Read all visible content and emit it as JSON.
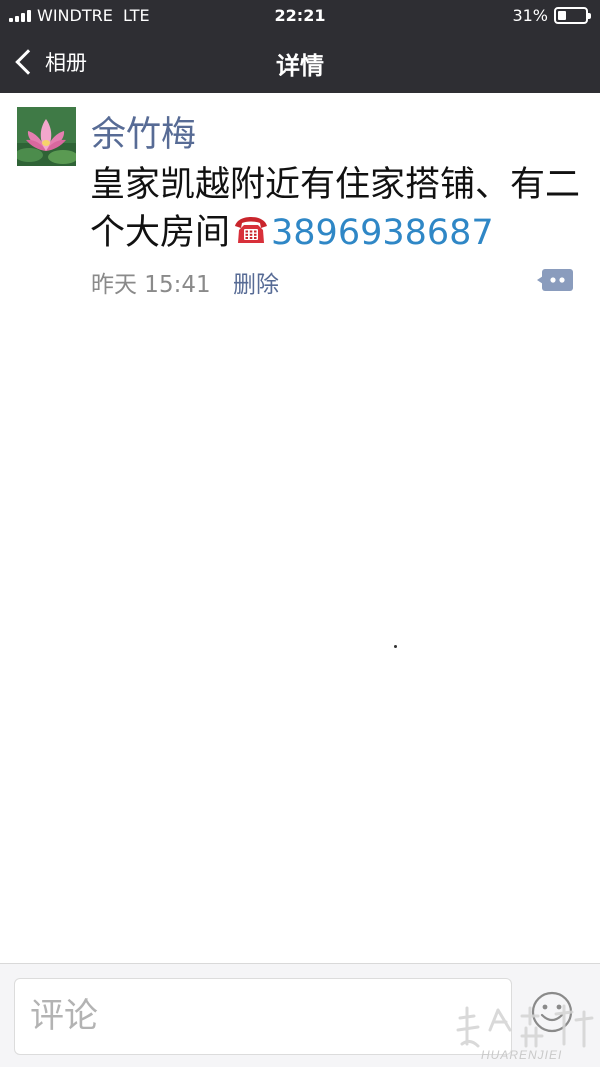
{
  "status_bar": {
    "carrier": "WINDTRE  LTE",
    "time": "22:21",
    "battery": "31%",
    "battery_level": 0.31
  },
  "nav": {
    "back_label": "相册",
    "title": "详情"
  },
  "post": {
    "author": "余竹梅",
    "text": "皇家凯越附近有住家搭铺、有二个大房间",
    "phone": "3896938687",
    "time": "昨天 15:41",
    "delete_label": "删除"
  },
  "comment": {
    "placeholder": "评论"
  },
  "icons": {
    "back": "chevron-left-icon",
    "phone": "telephone-icon",
    "more": "comment-more-icon",
    "emoji": "emoji-face-icon",
    "signal": "signal-bars-icon",
    "battery": "battery-icon"
  },
  "watermark": {
    "text": "HUARENJIEI",
    "lettering": "华人街"
  },
  "colors": {
    "nav_bg": "#2e2e33",
    "link_blue": "#576b95",
    "phone_blue": "#2f87c6",
    "text": "#111111",
    "muted": "#8a8a8a"
  }
}
